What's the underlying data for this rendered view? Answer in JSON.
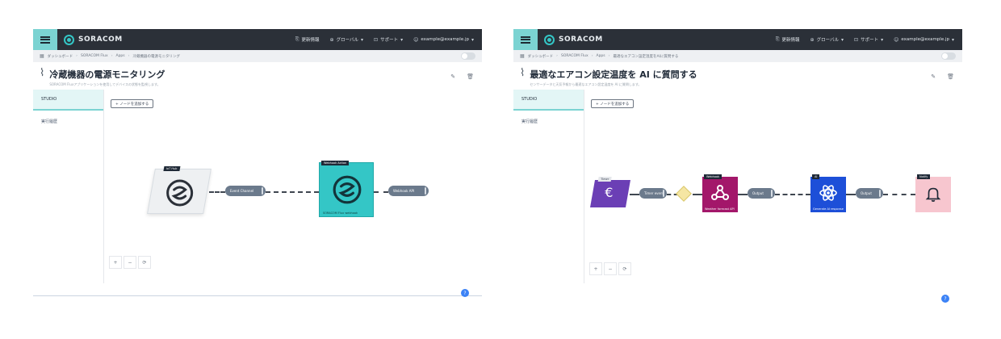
{
  "common": {
    "brand": "SORACOM",
    "nav": {
      "news": "更新情報",
      "global": "グローバル",
      "support": "サポート",
      "user": "example@example.jp"
    },
    "sidebar": {
      "studio": "STUDIO",
      "history": "実行履歴"
    },
    "add_node": "+ ノードを追加する",
    "zoom": [
      "+",
      "−",
      "⟳"
    ],
    "colors": {
      "topbar": "#2b3038",
      "accent": "#7bd3d2",
      "node_teal": "#34c6c6",
      "node_purple": "#6b3fb5",
      "node_magenta": "#a3176a",
      "node_blue": "#1d4fd8",
      "node_pink": "#f7c6cf",
      "pill": "#6b7a8c"
    }
  },
  "left": {
    "crumbs": [
      "ダッシュボード",
      "SORACOM Flux",
      "Apps",
      "冷蔵機器の電源モニタリング"
    ],
    "title": "冷蔵機器の電源モニタリング",
    "subtitle": "SORACOM Fluxアプリケーションを使用してデバイスの状態を監視します。",
    "nodes": {
      "source_tag": "IoT Hub",
      "action_tag": "Webhook Action",
      "action_label": "SORACOM Flux webhook"
    },
    "pills": {
      "first": "Event Channel",
      "second": "Webhook API"
    }
  },
  "right": {
    "crumbs": [
      "ダッシュボード",
      "SORACOM Flux",
      "Apps",
      "最適なエアコン設定温度をAIに質問する"
    ],
    "title": "最適なエアコン設定温度を AI に質問する",
    "subtitle": "センサーデータと天気予報から最適なエアコン設定温度を AI に質問します。",
    "nodes": {
      "euro_tag": "Timer",
      "webhook_tag": "Webhook",
      "webhook_label": "Weather forecast API",
      "ai_tag": "AI",
      "ai_label": "Generate AI response",
      "notify_tag": "Notify"
    },
    "pills": {
      "first": "Timer event",
      "second": "Output",
      "third": "Output"
    }
  }
}
